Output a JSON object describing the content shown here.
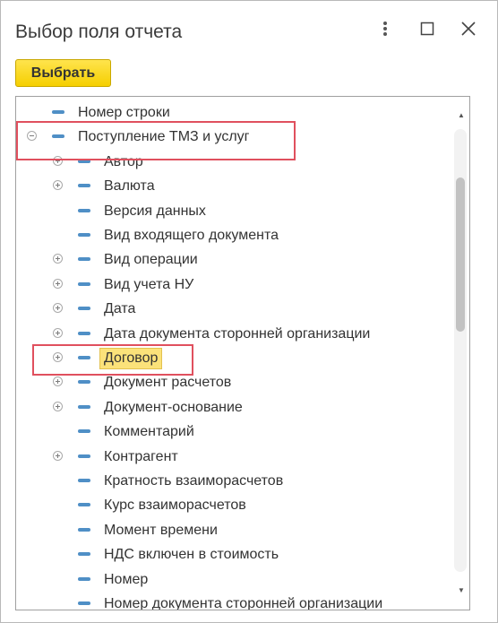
{
  "window": {
    "title": "Выбор поля отчета"
  },
  "controls": {
    "more_icon": "more-vertical-icon",
    "maximize_icon": "maximize-icon",
    "close_icon": "close-icon"
  },
  "toolbar": {
    "select_label": "Выбрать"
  },
  "tree": {
    "items": [
      {
        "label": "Номер строки",
        "expander": "none",
        "level": 0
      },
      {
        "label": "Поступление ТМЗ и услуг",
        "expander": "minus",
        "level": 0
      },
      {
        "label": "Автор",
        "expander": "plus",
        "level": 1
      },
      {
        "label": "Валюта",
        "expander": "plus",
        "level": 1
      },
      {
        "label": "Версия данных",
        "expander": "none",
        "level": 1
      },
      {
        "label": "Вид входящего документа",
        "expander": "none",
        "level": 1
      },
      {
        "label": "Вид операции",
        "expander": "plus",
        "level": 1
      },
      {
        "label": "Вид учета НУ",
        "expander": "plus",
        "level": 1
      },
      {
        "label": "Дата",
        "expander": "plus",
        "level": 1
      },
      {
        "label": "Дата документа сторонней организации",
        "expander": "plus",
        "level": 1
      },
      {
        "label": "Договор",
        "expander": "plus",
        "level": 1,
        "selected": true
      },
      {
        "label": "Документ расчетов",
        "expander": "plus",
        "level": 1
      },
      {
        "label": "Документ-основание",
        "expander": "plus",
        "level": 1
      },
      {
        "label": "Комментарий",
        "expander": "none",
        "level": 1
      },
      {
        "label": "Контрагент",
        "expander": "plus",
        "level": 1
      },
      {
        "label": "Кратность взаиморасчетов",
        "expander": "none",
        "level": 1
      },
      {
        "label": "Курс взаиморасчетов",
        "expander": "none",
        "level": 1
      },
      {
        "label": "Момент времени",
        "expander": "none",
        "level": 1
      },
      {
        "label": "НДС включен в стоимость",
        "expander": "none",
        "level": 1
      },
      {
        "label": "Номер",
        "expander": "none",
        "level": 1
      },
      {
        "label": "Номер документа сторонней организации",
        "expander": "none",
        "level": 1
      }
    ]
  },
  "colors": {
    "accent_button": "#f5cf00",
    "highlight": "#fbe27a",
    "annotation_box": "#e0505e",
    "field_dash": "#4f8fc6"
  }
}
